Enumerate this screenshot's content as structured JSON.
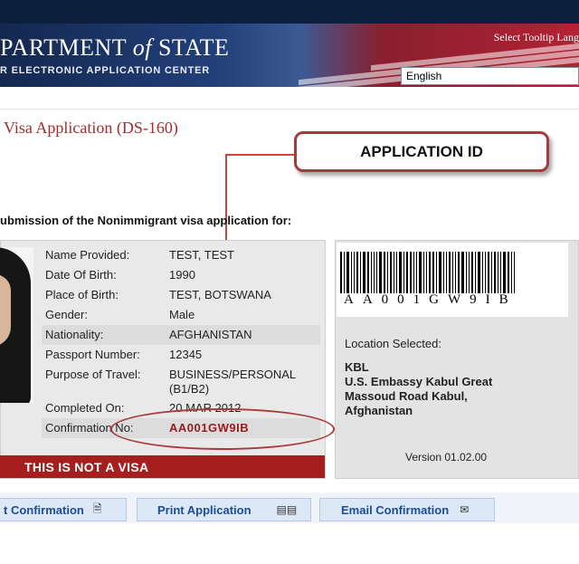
{
  "banner": {
    "title_main": "PARTMENT",
    "title_of": "of",
    "title_state": "STATE",
    "subtitle": "R ELECTRONIC APPLICATION CENTER",
    "tooltip_label": "Select Tooltip Lang",
    "language_value": "English"
  },
  "page": {
    "heading": "Visa Application (DS-160)",
    "intro": "ubmission of the Nonimmigrant visa application for:"
  },
  "callout": {
    "label": "APPLICATION ID"
  },
  "applicant": {
    "rows": [
      {
        "label": "Name Provided:",
        "value": "TEST, TEST"
      },
      {
        "label": "Date Of Birth:",
        "value": "1990"
      },
      {
        "label": "Place of Birth:",
        "value": "TEST, BOTSWANA"
      },
      {
        "label": "Gender:",
        "value": "Male"
      },
      {
        "label": "Nationality:",
        "value": "AFGHANISTAN"
      },
      {
        "label": "Passport Number:",
        "value": "12345"
      },
      {
        "label": "Purpose of Travel:",
        "value": "BUSINESS/PERSONAL",
        "value2": "(B1/B2)"
      },
      {
        "label": "Completed On:",
        "value": "20 MAR 2012"
      },
      {
        "label": "Confirmation No:",
        "value": "AA001GW9IB"
      }
    ],
    "not_visa": "THIS IS NOT A VISA"
  },
  "barcode": {
    "text": "AA001GW9IB"
  },
  "location": {
    "label": "Location Selected:",
    "lines": [
      "KBL",
      "U.S. Embassy Kabul Great",
      "Massoud Road Kabul,",
      "Afghanistan"
    ]
  },
  "version": "Version 01.02.00",
  "buttons": {
    "print_confirmation": "t Confirmation",
    "print_application": "Print Application",
    "email_confirmation": "Email Confirmation"
  },
  "icons": {
    "document": "document-icon",
    "printer": "printer-icon",
    "email": "email-icon"
  },
  "colors": {
    "brand_red": "#a61e1e",
    "link_blue": "#1c4b9a",
    "navy": "#14284f"
  }
}
